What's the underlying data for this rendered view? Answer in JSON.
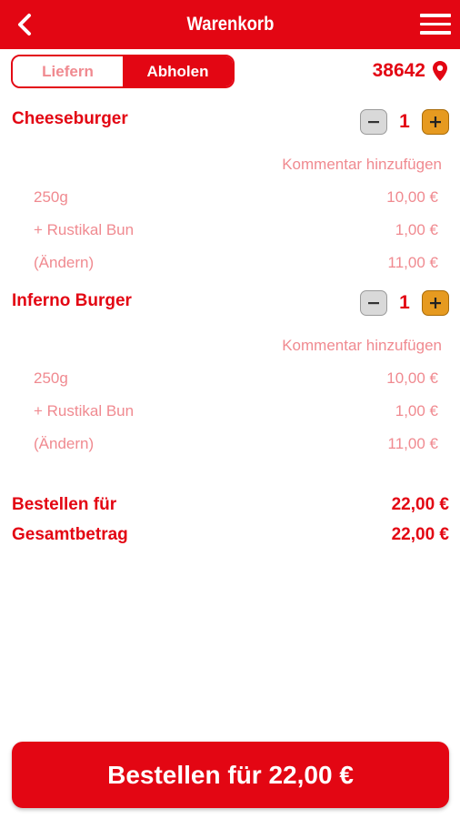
{
  "header": {
    "title": "Warenkorb"
  },
  "mode_toggle": {
    "deliver_label": "Liefern",
    "pickup_label": "Abholen",
    "selected": "Abholen"
  },
  "location": {
    "postal_code": "38642"
  },
  "cart": {
    "items": [
      {
        "name": "Cheeseburger",
        "quantity": "1",
        "comment_label": "Kommentar hinzufügen",
        "lines": [
          {
            "label": "250g",
            "price": "10,00 €"
          },
          {
            "label": "+ Rustikal Bun",
            "price": "1,00 €"
          },
          {
            "label": "(Ändern)",
            "price": "11,00 €"
          }
        ]
      },
      {
        "name": "Inferno Burger",
        "quantity": "1",
        "comment_label": "Kommentar hinzufügen",
        "lines": [
          {
            "label": "250g",
            "price": "10,00 €"
          },
          {
            "label": "+ Rustikal Bun",
            "price": "1,00 €"
          },
          {
            "label": "(Ändern)",
            "price": "11,00 €"
          }
        ]
      }
    ]
  },
  "summary": {
    "order_for_label": "Bestellen für",
    "order_for_value": "22,00 €",
    "total_label": "Gesamtbetrag",
    "total_value": "22,00 €"
  },
  "order_button": {
    "label": "Bestellen für 22,00 €"
  },
  "colors": {
    "brand_red": "#e30613",
    "muted_pink": "#f08a90",
    "plus_orange": "#e69a20",
    "minus_grey": "#d9d9d9"
  },
  "icons": {
    "back": "chevron-left-icon",
    "menu": "hamburger-menu-icon",
    "location": "map-pin-icon",
    "minus": "minus-icon",
    "plus": "plus-icon"
  }
}
